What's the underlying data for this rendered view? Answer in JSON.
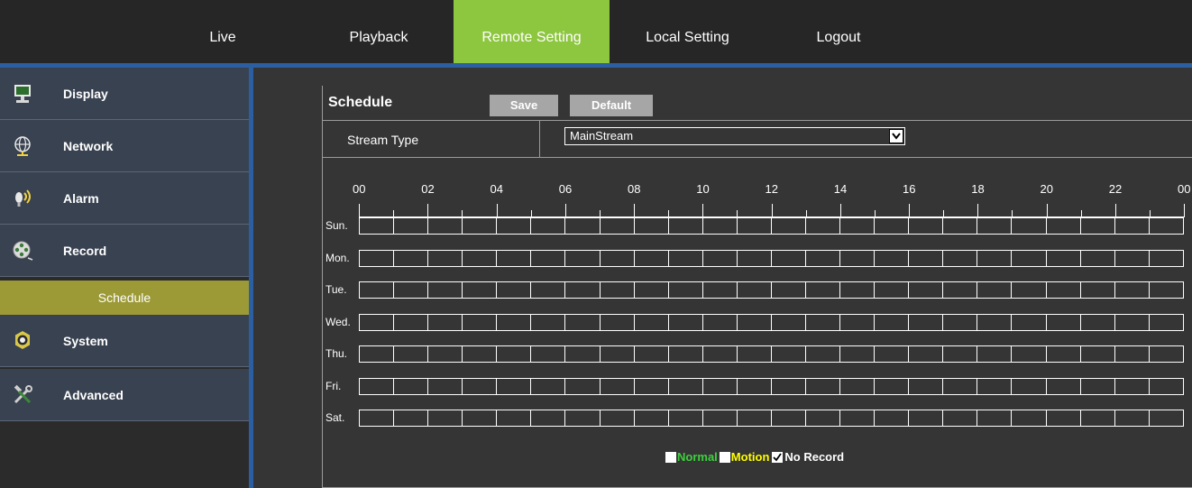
{
  "nav": {
    "items": [
      {
        "label": "Live",
        "active": false
      },
      {
        "label": "Playback",
        "active": false
      },
      {
        "label": "Remote Setting",
        "active": true
      },
      {
        "label": "Local Setting",
        "active": false
      },
      {
        "label": "Logout",
        "active": false
      }
    ],
    "colors": {
      "active": "#8dc63f",
      "bar": "#262626",
      "accent_line": "#2b5fa1"
    }
  },
  "sidebar": {
    "items": [
      {
        "label": "Display",
        "icon": "monitor-icon"
      },
      {
        "label": "Network",
        "icon": "globe-network-icon"
      },
      {
        "label": "Alarm",
        "icon": "alarm-bulb-icon"
      },
      {
        "label": "Record",
        "icon": "film-reel-icon"
      },
      {
        "label": "System",
        "icon": "gear-icon"
      },
      {
        "label": "Advanced",
        "icon": "tools-icon"
      }
    ],
    "subitem": {
      "label": "Schedule",
      "color": "#9c9a36"
    }
  },
  "schedule": {
    "title": "Schedule",
    "save_label": "Save",
    "default_label": "Default",
    "stream_type_label": "Stream Type",
    "stream_type_value": "MainStream",
    "hours": [
      "00",
      "02",
      "04",
      "06",
      "08",
      "10",
      "12",
      "14",
      "16",
      "18",
      "20",
      "22",
      "00"
    ],
    "days": [
      "Sun.",
      "Mon.",
      "Tue.",
      "Wed.",
      "Thu.",
      "Fri.",
      "Sat."
    ],
    "slots_per_day": 24
  },
  "legend": {
    "normal": {
      "label": "Normal",
      "color": "#3dd13d",
      "checked": false
    },
    "motion": {
      "label": "Motion",
      "color": "#ffff00",
      "checked": false
    },
    "norecord": {
      "label": "No Record",
      "color": "#ffffff",
      "checked": true
    }
  }
}
